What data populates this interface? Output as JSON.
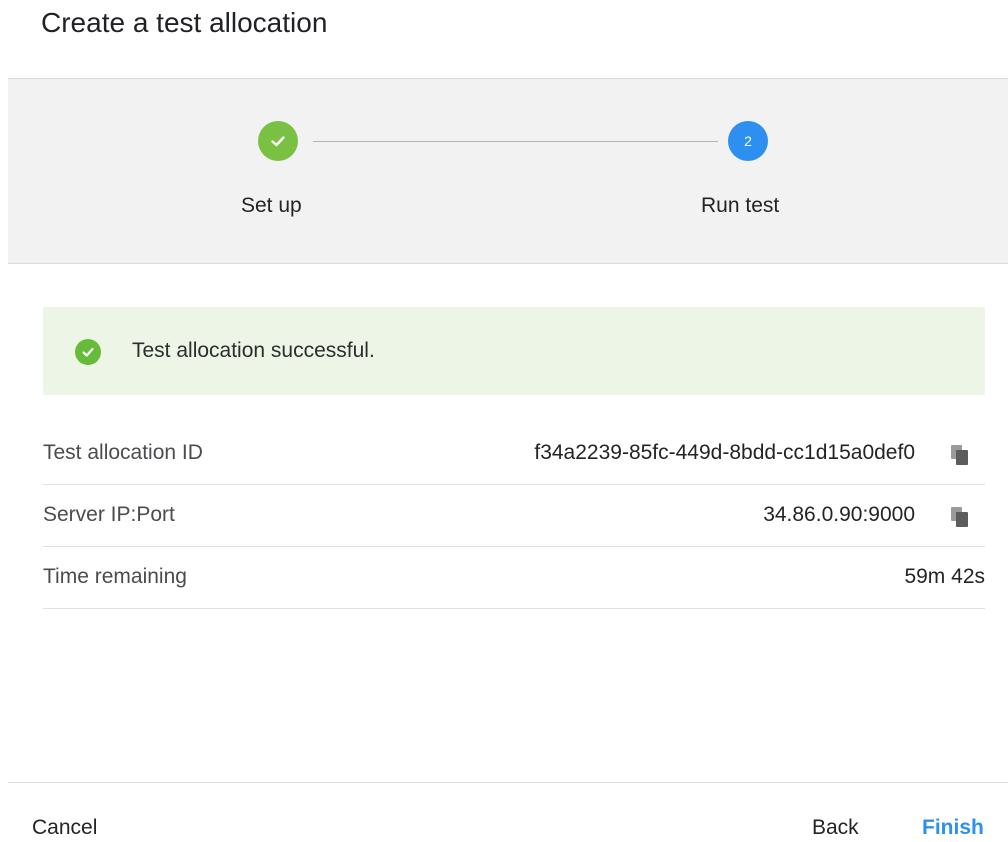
{
  "dialog": {
    "title": "Create a test allocation"
  },
  "stepper": {
    "steps": [
      {
        "label": "Set up",
        "status": "complete",
        "marker": "check-icon",
        "color": "#7ac143"
      },
      {
        "label": "Run test",
        "status": "active",
        "marker": "2",
        "color": "#2d8ff0"
      }
    ]
  },
  "alert": {
    "message": "Test allocation successful.",
    "icon": "check-circle-icon",
    "color": "#66bb3a",
    "background": "#edf6e6"
  },
  "details": [
    {
      "label": "Test allocation ID",
      "value": "f34a2239-85fc-449d-8bdd-cc1d15a0def0",
      "copyable": true
    },
    {
      "label": "Server IP:Port",
      "value": "34.86.0.90:9000",
      "copyable": true
    },
    {
      "label": "Time remaining",
      "value": "59m 42s",
      "copyable": false
    }
  ],
  "footer": {
    "cancel_label": "Cancel",
    "back_label": "Back",
    "finish_label": "Finish",
    "accent_color": "#2d8ff0"
  }
}
